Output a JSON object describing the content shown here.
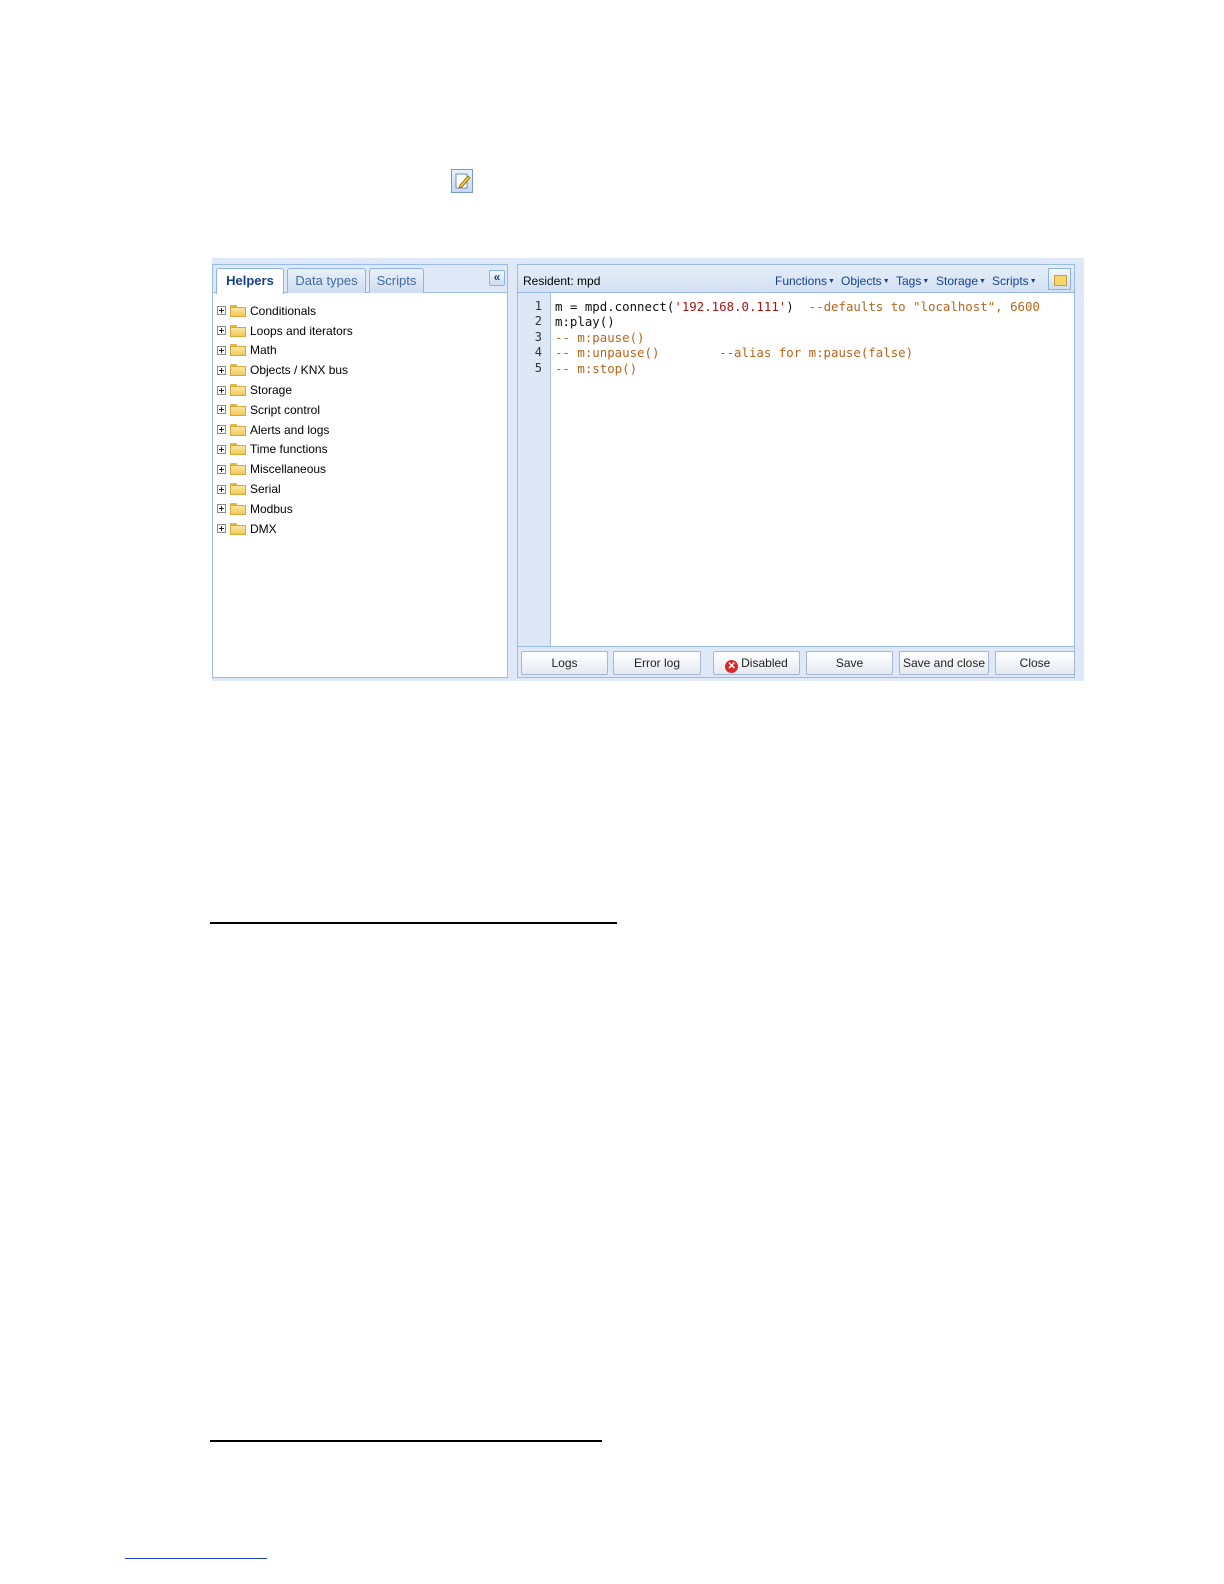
{
  "tabs": [
    "Helpers",
    "Data types",
    "Scripts"
  ],
  "collapse_glyph": "«",
  "tree_items": [
    "Conditionals",
    "Loops and iterators",
    "Math",
    "Objects / KNX bus",
    "Storage",
    "Script control",
    "Alerts and logs",
    "Time functions",
    "Miscellaneous",
    "Serial",
    "Modbus",
    "DMX"
  ],
  "editor": {
    "title": "Resident: mpd",
    "menus": [
      "Functions",
      "Objects",
      "Tags",
      "Storage",
      "Scripts"
    ],
    "line_numbers": [
      "1",
      "2",
      "3",
      "4",
      "5"
    ],
    "code": {
      "l1_a": "m = mpd.connect(",
      "l1_str": "'192.168.0.111'",
      "l1_b": ")  ",
      "l1_comment": "--defaults to \"localhost\", 6600",
      "l2": "m:play()",
      "l3": "-- m:pause()",
      "l4": "-- m:unpause()        --alias for m:pause(false)",
      "l5": "-- m:stop()"
    }
  },
  "buttons": {
    "logs": "Logs",
    "error_log": "Error log",
    "disabled": "Disabled",
    "save": "Save",
    "save_close": "Save and close",
    "close": "Close"
  },
  "icons": {
    "edit": "edit-script-icon",
    "folder": "folder-icon",
    "expander": "plus-expander-icon",
    "disabled": "red-x-circle-icon",
    "note": "sticky-note-icon"
  },
  "colors": {
    "panel_bg": "#dfe8f6",
    "border": "#99bbe8",
    "string": "#a31515",
    "comment": "#b5651d"
  }
}
